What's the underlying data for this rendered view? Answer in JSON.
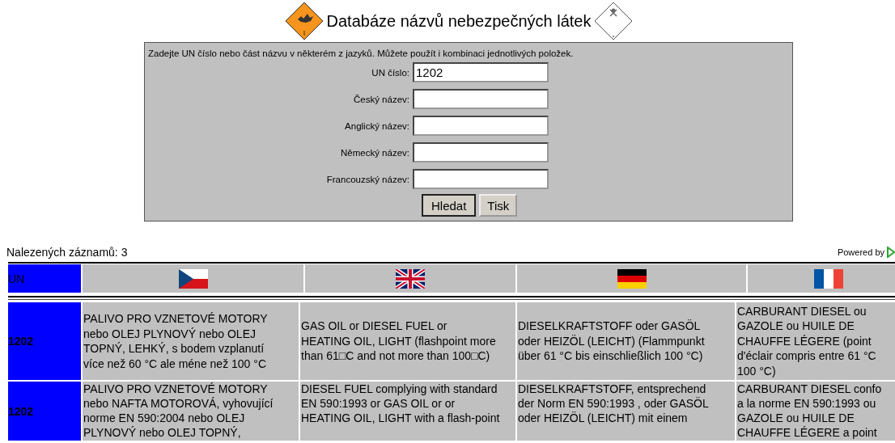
{
  "header": {
    "title": "Databáze názvů nebezpečných látek"
  },
  "form": {
    "instruction": "Zadejte UN číslo nebo část názvu v některém z jazyků. Můžete použít i kombinaci jednotlivých položek.",
    "fields": [
      {
        "label": "UN číslo:",
        "value": "1202"
      },
      {
        "label": "Český název:"
      },
      {
        "label": "Anglický název:"
      },
      {
        "label": "Německý název:"
      },
      {
        "label": "Francouzský název:"
      }
    ],
    "buttons": [
      "Hledat",
      "Tisk"
    ]
  },
  "results": {
    "count_text": "Nalezených záznamů: 3",
    "powered_by": "Powered by"
  },
  "table": {
    "un_heading": "UN",
    "rows": [
      {
        "un": "1202",
        "cells": [
          "PALIVO PRO VZNETOVÉ MOTORY\nnebo OLEJ PLYNOVÝ nebo OLEJ\nTOPNÝ, LEHKÝ, s bodem vzplanutí\nvíce než 60 °C ale méne než 100 °C",
          "GAS OIL or DIESEL FUEL or\nHEATING OIL, LIGHT (flashpoint more\nthan 61□C and not more than 100□C)",
          "DIESELKRAFTSTOFF oder GASÖL\noder HEIZÖL (LEICHT) (Flammpunkt\nüber 61 °C bis einschließlich 100 °C)",
          "CARBURANT DIESEL ou\nGAZOLE ou HUILE DE\nCHAUFFE LÉGERE (point\nd'éclair compris entre 61 °C\n100 °C)"
        ]
      },
      {
        "un": "1202",
        "cells": [
          "PALIVO PRO VZNETOVÉ MOTORY\nnebo NAFTA MOTOROVÁ, vyhovující\nnorme EN 590:2004 nebo OLEJ\nPLYNOVÝ nebo OLEJ TOPNÝ,",
          "DIESEL FUEL complying with standard\nEN 590:1993 or GAS OIL or or\nHEATING OIL, LIGHT with a flash-point",
          "DIESELKRAFTSTOFF, entsprechend\nder Norm EN 590:1993 , oder GASÖL\noder HEIZÖL (LEICHT) mit einem",
          "CARBURANT DIESEL confo\na la norme EN 590:1993 ou\nGAZOLE ou HUILE DE\nCHAUFFE LÉGERE a point"
        ]
      }
    ]
  }
}
